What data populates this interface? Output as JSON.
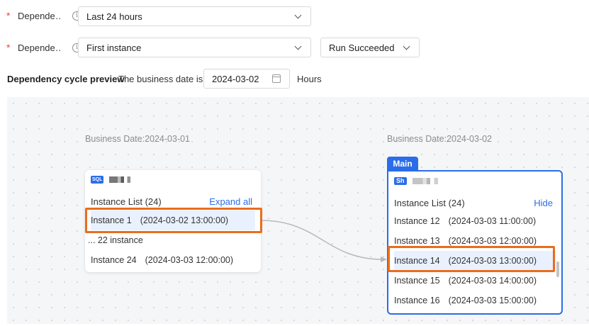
{
  "form": {
    "field1": {
      "label": "Depende…",
      "value": "Last 24 hours"
    },
    "field2": {
      "label": "Depende…",
      "value": "First instance",
      "status_value": "Run Succeeded"
    },
    "required_mark": "*",
    "info_glyph": "i"
  },
  "preview": {
    "title": "Dependency cycle preview",
    "business_date_text": "The business date is",
    "date_value": "2024-03-02",
    "hours_text": "Hours"
  },
  "left_node": {
    "business_date": "Business Date:2024-03-01",
    "tag": "SQL",
    "list_title": "Instance List (24)",
    "expand_label": "Expand all",
    "instances": [
      {
        "name": "Instance 1",
        "time": "(2024-03-02 13:00:00)"
      },
      {
        "name": "... 22 instance",
        "time": ""
      },
      {
        "name": "Instance 24",
        "time": "(2024-03-03 12:00:00)"
      }
    ]
  },
  "right_node": {
    "business_date": "Business Date:2024-03-02",
    "main_tab": "Main",
    "tag": "Sh",
    "list_title": "Instance List (24)",
    "hide_label": "Hide",
    "instances": [
      {
        "name": "Instance 12",
        "time": "(2024-03-03 11:00:00)"
      },
      {
        "name": "Instance 13",
        "time": "(2024-03-03 12:00:00)"
      },
      {
        "name": "Instance 14",
        "time": "(2024-03-03 13:00:00)"
      },
      {
        "name": "Instance 15",
        "time": "(2024-03-03 14:00:00)"
      },
      {
        "name": "Instance 16",
        "time": "(2024-03-03 15:00:00)"
      }
    ]
  },
  "colors": {
    "accent": "#2b6de8",
    "highlight": "#ea6d1c",
    "required": "#e5484d"
  }
}
